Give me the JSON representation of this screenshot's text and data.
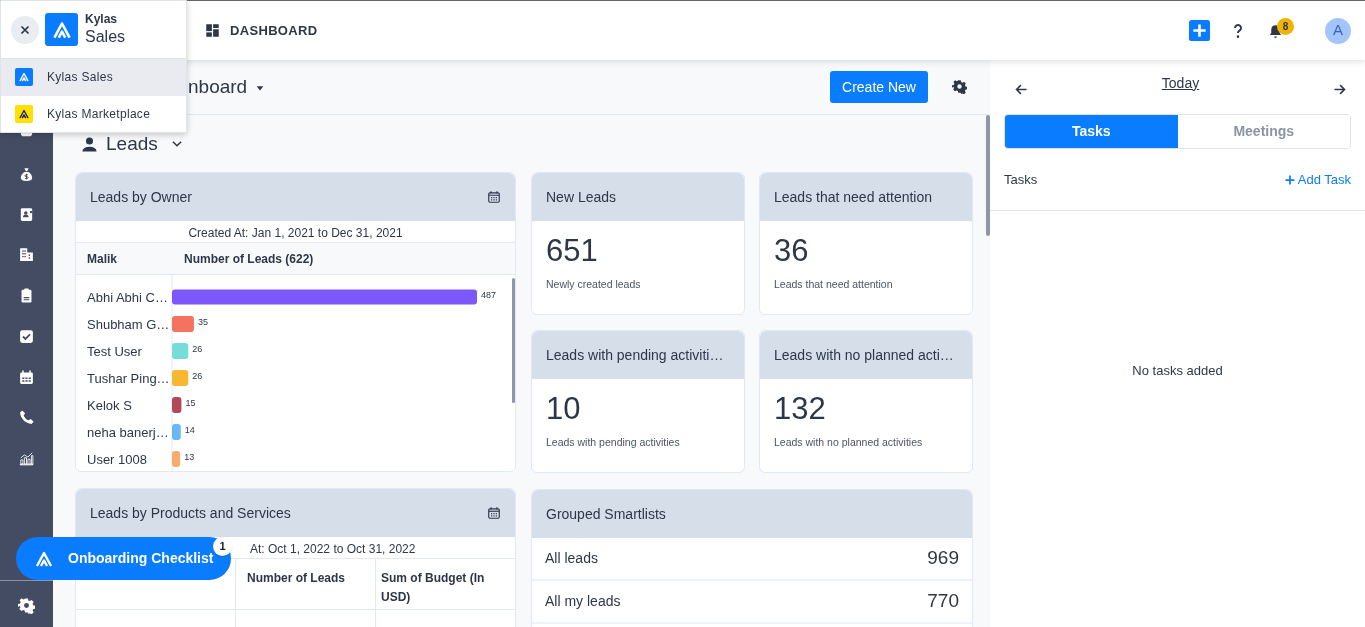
{
  "app_switcher": {
    "brand_top": "Kylas",
    "brand_bottom": "Sales",
    "items": [
      {
        "label": "Kylas Sales",
        "selected": true,
        "color": "#0a7cff"
      },
      {
        "label": "Kylas Marketplace",
        "selected": false,
        "color": "#ffe100"
      }
    ]
  },
  "top_bar": {
    "page": "DASHBOARD",
    "notification_count": "8",
    "avatar": "A"
  },
  "main": {
    "title": "nboard",
    "create_button": "Create New",
    "entity": "Leads"
  },
  "owner_widget": {
    "title": "Leads by Owner",
    "subtitle": "Created At: Jan 1, 2021 to Dec 31, 2021",
    "columns": [
      "Malik",
      "Number of Leads (622)"
    ],
    "chart_data": {
      "type": "bar",
      "orientation": "horizontal",
      "data_labels": true,
      "categories": [
        "Abhi Abhi C…",
        "Shubham G…",
        "Test User",
        "Tushar Ping…",
        "Kelok S",
        "neha banerj…",
        "User 1008"
      ],
      "values": [
        487,
        35,
        26,
        26,
        15,
        14,
        13
      ]
    }
  },
  "stat_cards": [
    {
      "title": "New Leads",
      "value": "651",
      "caption": "Newly created leads"
    },
    {
      "title": "Leads that need attention",
      "value": "36",
      "caption": "Leads that need attention"
    },
    {
      "title": "Leads with pending activiti…",
      "value": "10",
      "caption": "Leads with pending activities"
    },
    {
      "title": "Leads with no planned acti…",
      "value": "132",
      "caption": "Leads with no planned activities"
    }
  ],
  "products_widget": {
    "title": "Leads by Products and Services",
    "subtitle": "At: Oct 1, 2022 to Oct 31, 2022",
    "columns": [
      "Number of Leads",
      "Sum of Budget (In USD)"
    ]
  },
  "smartlists": {
    "title": "Grouped Smartlists",
    "rows": [
      {
        "label": "All leads",
        "count": "969"
      },
      {
        "label": "All my leads",
        "count": "770"
      }
    ]
  },
  "onboarding": {
    "label": "Onboarding Checklist",
    "badge": "1"
  },
  "right_panel": {
    "date": "Today",
    "tabs": [
      {
        "label": "Tasks",
        "selected": true
      },
      {
        "label": "Meetings",
        "selected": false
      }
    ],
    "section": "Tasks",
    "add": "Add Task",
    "empty": "No tasks added"
  }
}
